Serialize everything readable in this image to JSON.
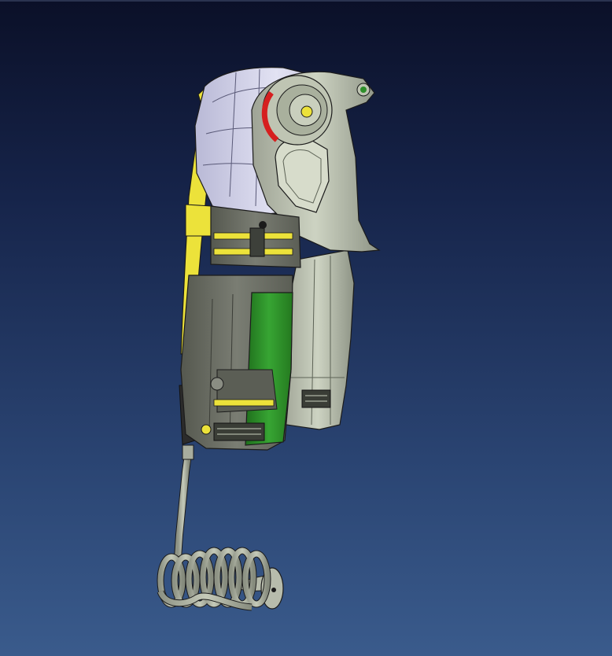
{
  "viewer": {
    "background_top": "#0b1028",
    "background_bottom": "#3a5b8c"
  },
  "model": {
    "icon": "power-drill-3d-model",
    "colors": {
      "housing": "#c9d1bd",
      "head": "#d9d9ee",
      "accent_yellow": "#ece23a",
      "motor_green": "#2e8f2a",
      "dark_body": "#6b6e66",
      "chuck_red": "#d61f1f",
      "edges": "#1b1b1b"
    }
  }
}
